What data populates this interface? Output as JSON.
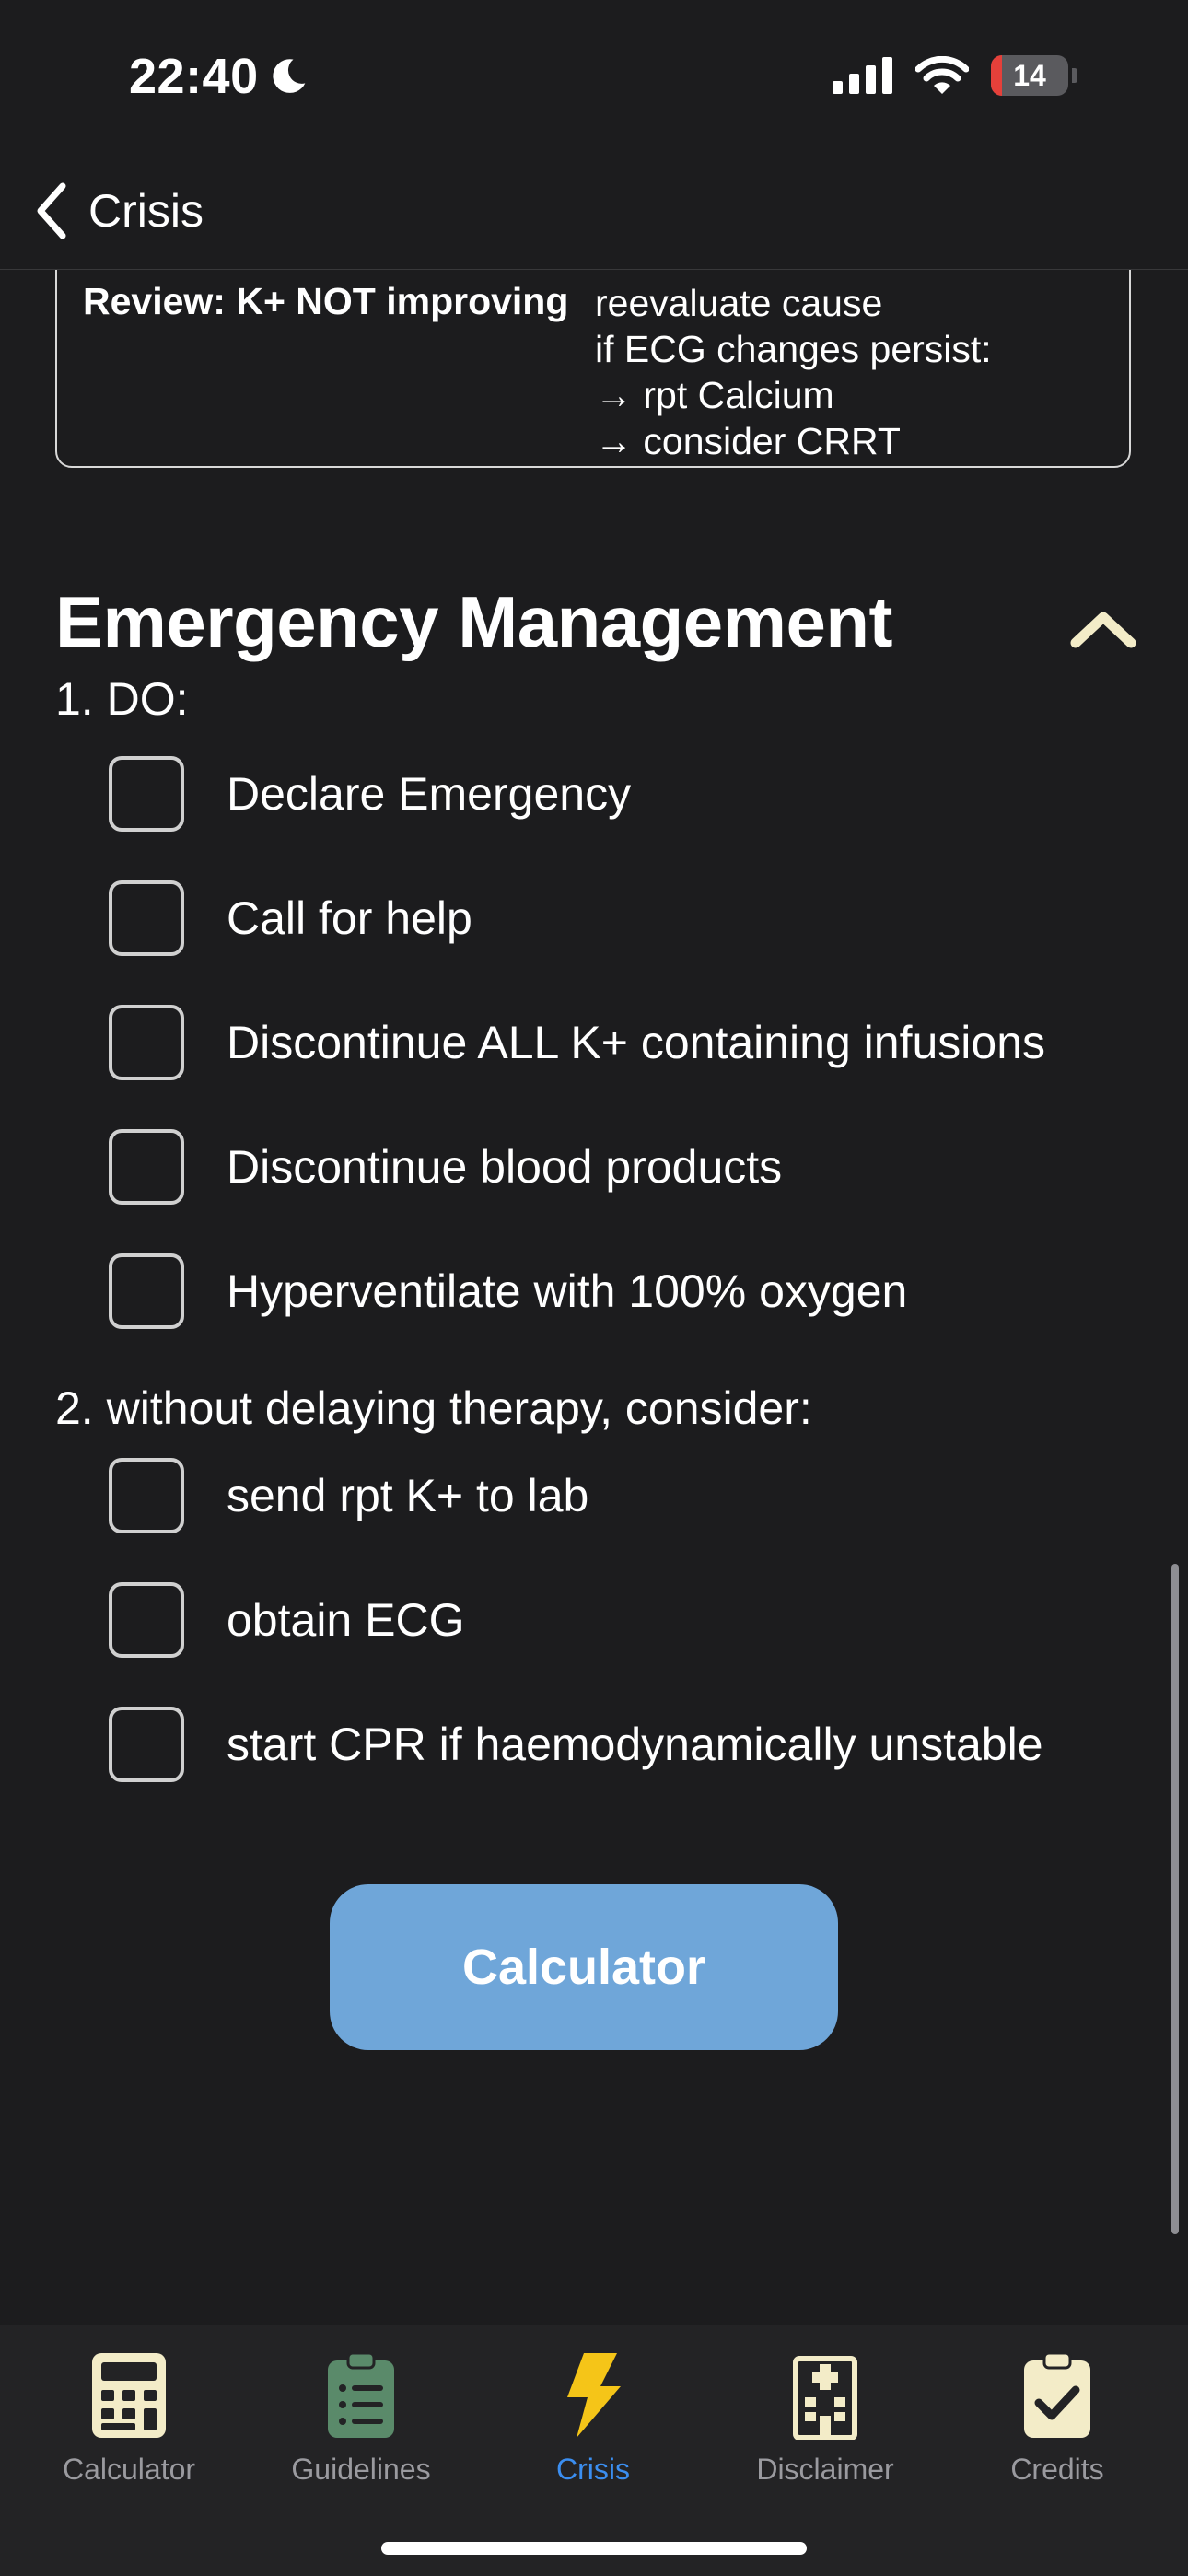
{
  "status_bar": {
    "time": "22:40",
    "battery": "14",
    "battery_level": 0.14
  },
  "nav": {
    "back_label": "Crisis"
  },
  "review": {
    "key": "Review: K+ NOT improving",
    "lines": [
      "reevaluate cause",
      "if ECG changes persist:",
      "→ rpt Calcium",
      "→ consider CRRT"
    ]
  },
  "section": {
    "title": "Emergency Management"
  },
  "groups": [
    {
      "label": "1. DO:",
      "items": [
        {
          "label": "Declare Emergency",
          "checked": false
        },
        {
          "label": "Call for help",
          "checked": false
        },
        {
          "label": "Discontinue ALL K+ containing infusions",
          "checked": false
        },
        {
          "label": "Discontinue blood products",
          "checked": false
        },
        {
          "label": "Hyperventilate with 100% oxygen",
          "checked": false
        }
      ]
    },
    {
      "label": "2. without delaying therapy, consider:",
      "items": [
        {
          "label": "send rpt K+ to lab",
          "checked": false
        },
        {
          "label": "obtain ECG",
          "checked": false
        },
        {
          "label": "start CPR if haemodynamically unstable",
          "checked": false
        }
      ]
    }
  ],
  "calculator_button": {
    "label": "Calculator"
  },
  "tabs": [
    {
      "label": "Calculator",
      "icon": "calculator-icon"
    },
    {
      "label": "Guidelines",
      "icon": "clipboard-list-icon"
    },
    {
      "label": "Crisis",
      "icon": "lightning-bolt-icon",
      "active": true
    },
    {
      "label": "Disclaimer",
      "icon": "hospital-icon"
    },
    {
      "label": "Credits",
      "icon": "clipboard-check-icon"
    }
  ],
  "colors": {
    "background": "#1c1c1e",
    "accent_tab": "#3b8ef0",
    "crisis_icon": "#f5c518",
    "button": "#6fa6d9",
    "collapse_chevron": "#f3ecc8",
    "battery_low": "#e5403a",
    "guidelines_icon": "#5a8a6a"
  }
}
